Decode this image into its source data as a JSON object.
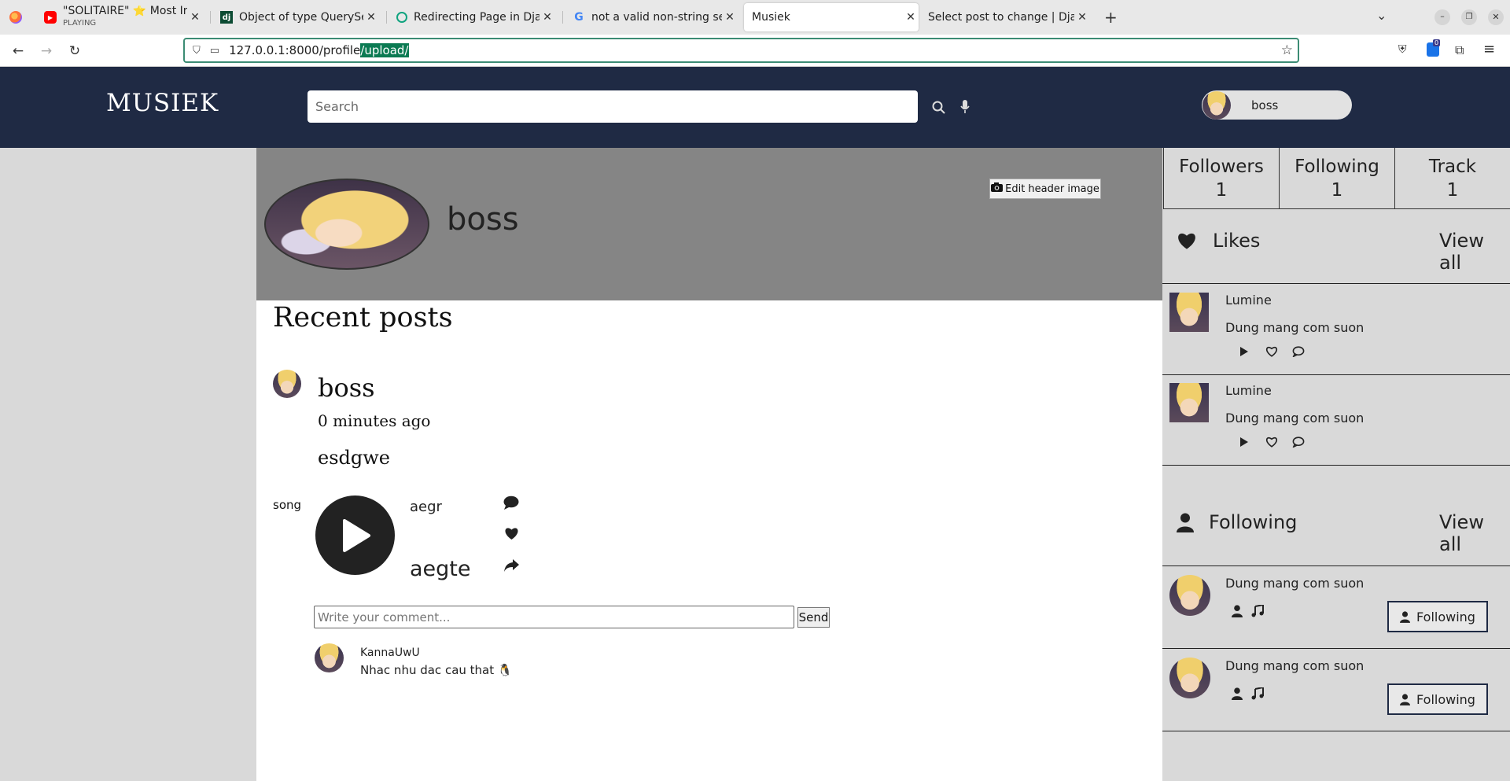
{
  "browser": {
    "tabs": [
      {
        "title": "\"SOLITAIRE\" ⭐ Most Inte",
        "subtitle": "PLAYING"
      },
      {
        "title": "Object of type QuerySet"
      },
      {
        "title": "Redirecting Page in Djang"
      },
      {
        "title": "not a valid non-string seq"
      },
      {
        "title": "Musiek"
      },
      {
        "title": "Select post to change | Djang"
      }
    ],
    "url_base": "127.0.0.1:8000/profile",
    "url_selected": "/upload/",
    "tab_count_badge": "0"
  },
  "site": {
    "logo": "MUSIEK",
    "search_placeholder": "Search",
    "user": {
      "name": "boss"
    }
  },
  "profile": {
    "name": "boss",
    "edit_header_label": "Edit header image"
  },
  "posts": {
    "section_title": "Recent posts",
    "items": [
      {
        "author": "boss",
        "time": "0 minutes ago",
        "body": "esdgwe",
        "label": "song",
        "track_artist": "aegr",
        "track_title": "aegte",
        "comment_placeholder": "Write your comment...",
        "send_label": "Send",
        "comments": [
          {
            "author": "KannaUwU",
            "text": "Nhac nhu dac cau that 🐧"
          }
        ]
      }
    ]
  },
  "sidebar": {
    "stats": [
      {
        "label": "Followers",
        "value": "1"
      },
      {
        "label": "Following",
        "value": "1"
      },
      {
        "label": "Track",
        "value": "1"
      }
    ],
    "likes": {
      "title": "Likes",
      "view_all": "View all",
      "items": [
        {
          "artist": "Lumine",
          "title": "Dung mang com suon"
        },
        {
          "artist": "Lumine",
          "title": "Dung mang com suon"
        }
      ]
    },
    "following": {
      "title": "Following",
      "view_all": "View all",
      "items": [
        {
          "name": "Dung mang com suon",
          "button": "Following"
        },
        {
          "name": "Dung mang com suon",
          "button": "Following"
        }
      ]
    }
  }
}
